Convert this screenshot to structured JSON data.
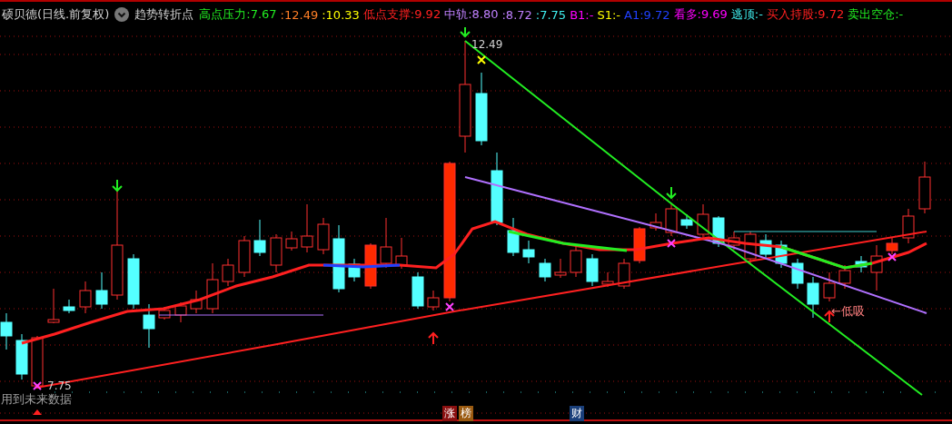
{
  "header": {
    "title": "硕贝德(日线.前复权)",
    "indicator": "趋势转折点",
    "legend": [
      {
        "text": "高点压力:7.67",
        "color": "#22ee22"
      },
      {
        "text": ":12.49",
        "color": "#ff7f27"
      },
      {
        "text": ":10.33",
        "color": "#ffff00"
      },
      {
        "text": "低点支撑:9.92",
        "color": "#ff2020"
      },
      {
        "text": "中轨:8.80",
        "color": "#c080ff"
      },
      {
        "text": ":8.72",
        "color": "#c080ff"
      },
      {
        "text": ":7.75",
        "color": "#40f0f0"
      },
      {
        "text": "B1:-",
        "color": "#ff00ff"
      },
      {
        "text": "S1:-",
        "color": "#ffff00"
      },
      {
        "text": "A1:9.72",
        "color": "#2040ff"
      },
      {
        "text": "看多:9.69",
        "color": "#ff00ff"
      },
      {
        "text": "逃顶:-",
        "color": "#40f0f0"
      },
      {
        "text": "买入持股:9.72",
        "color": "#ff2020"
      },
      {
        "text": "卖出空仓:-",
        "color": "#22ee22"
      }
    ]
  },
  "chart": {
    "high_label": "12.49",
    "low_label": "7.75",
    "buy_label": "←低吸",
    "warning": "用到未来数据"
  },
  "badges": [
    {
      "text": "涨",
      "color": "#8b1010"
    },
    {
      "text": "榜",
      "color": "#9a5a10"
    },
    {
      "text": "财",
      "color": "#1a3f7a"
    }
  ]
}
